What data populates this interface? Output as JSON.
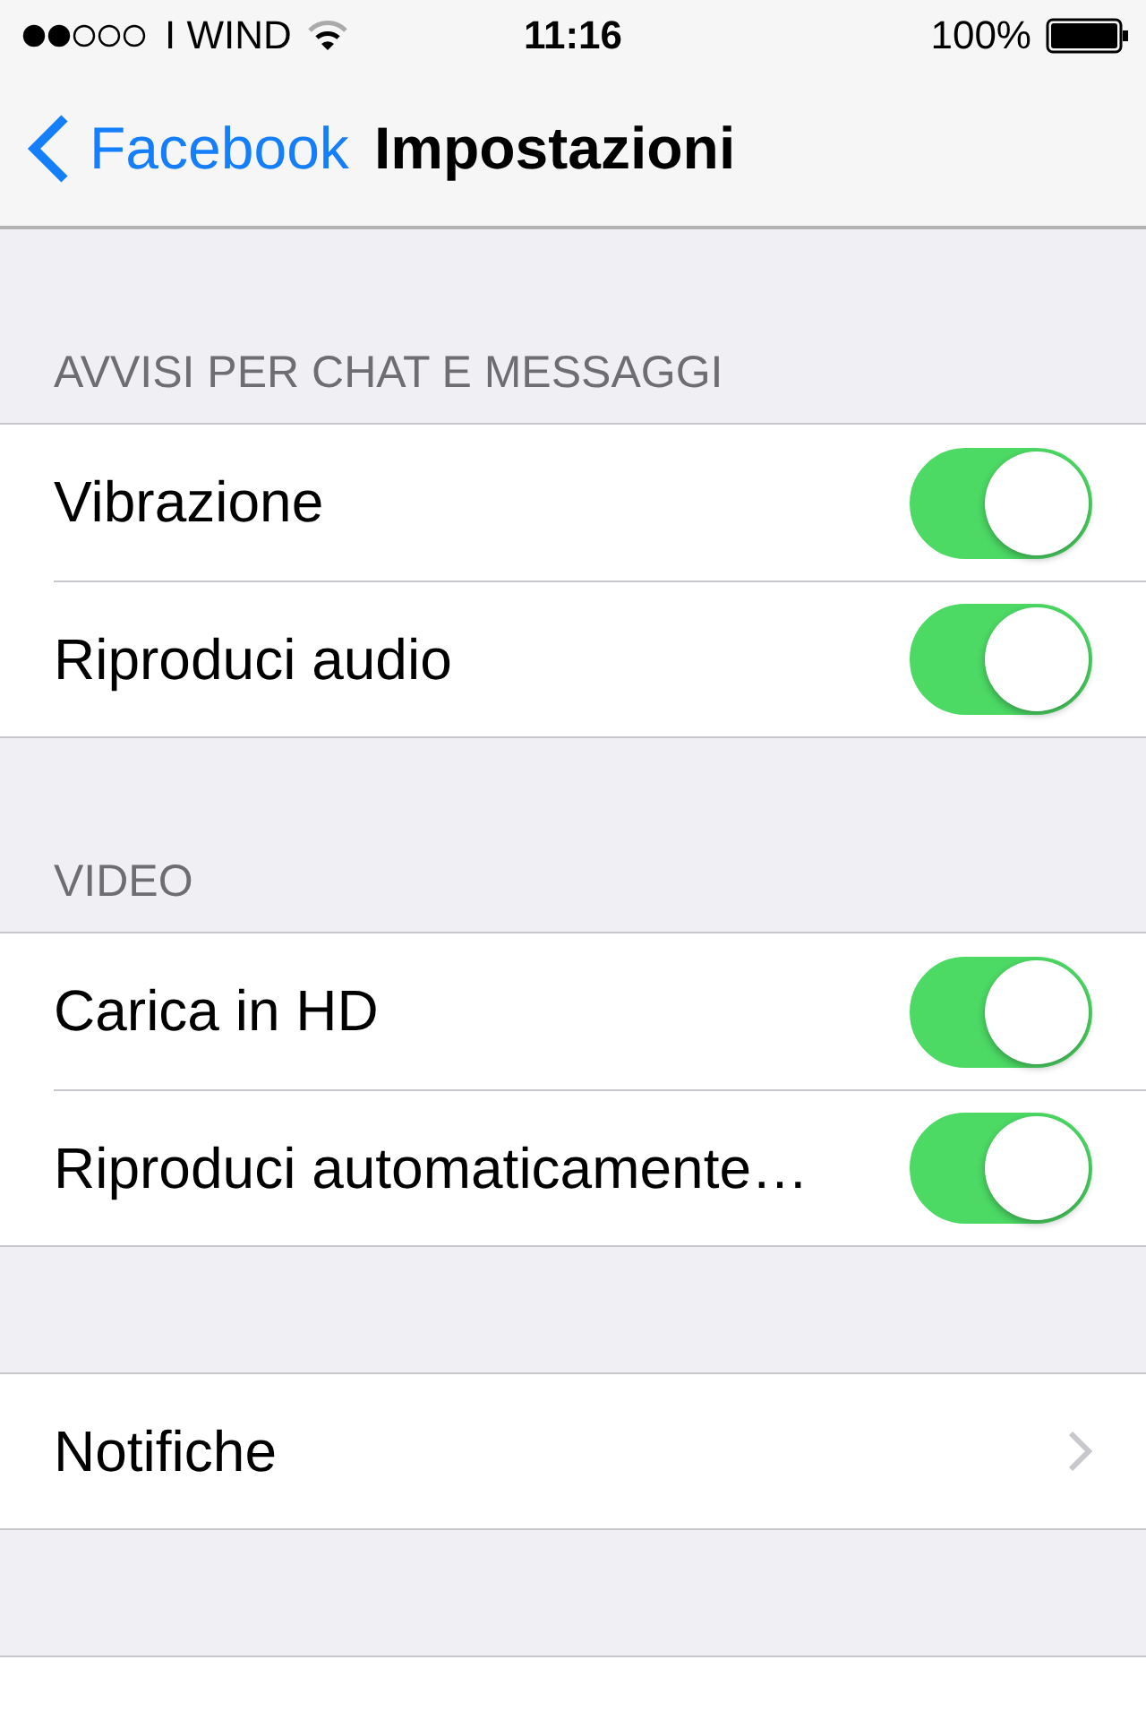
{
  "status_bar": {
    "carrier": "I WIND",
    "time": "11:16",
    "battery": "100%"
  },
  "nav": {
    "back": "Facebook",
    "title": "Impostazioni"
  },
  "sections": [
    {
      "header": "AVVISI PER CHAT E MESSAGGI",
      "rows": [
        {
          "kind": "toggle",
          "label": "Vibrazione",
          "on": true
        },
        {
          "kind": "toggle",
          "label": "Riproduci audio",
          "on": true
        }
      ]
    },
    {
      "header": "VIDEO",
      "rows": [
        {
          "kind": "toggle",
          "label": "Carica in HD",
          "on": true
        },
        {
          "kind": "toggle",
          "label": "Riproduci automaticamente…",
          "on": true
        }
      ]
    },
    {
      "rows": [
        {
          "kind": "link",
          "label": "Notifiche"
        }
      ]
    }
  ]
}
